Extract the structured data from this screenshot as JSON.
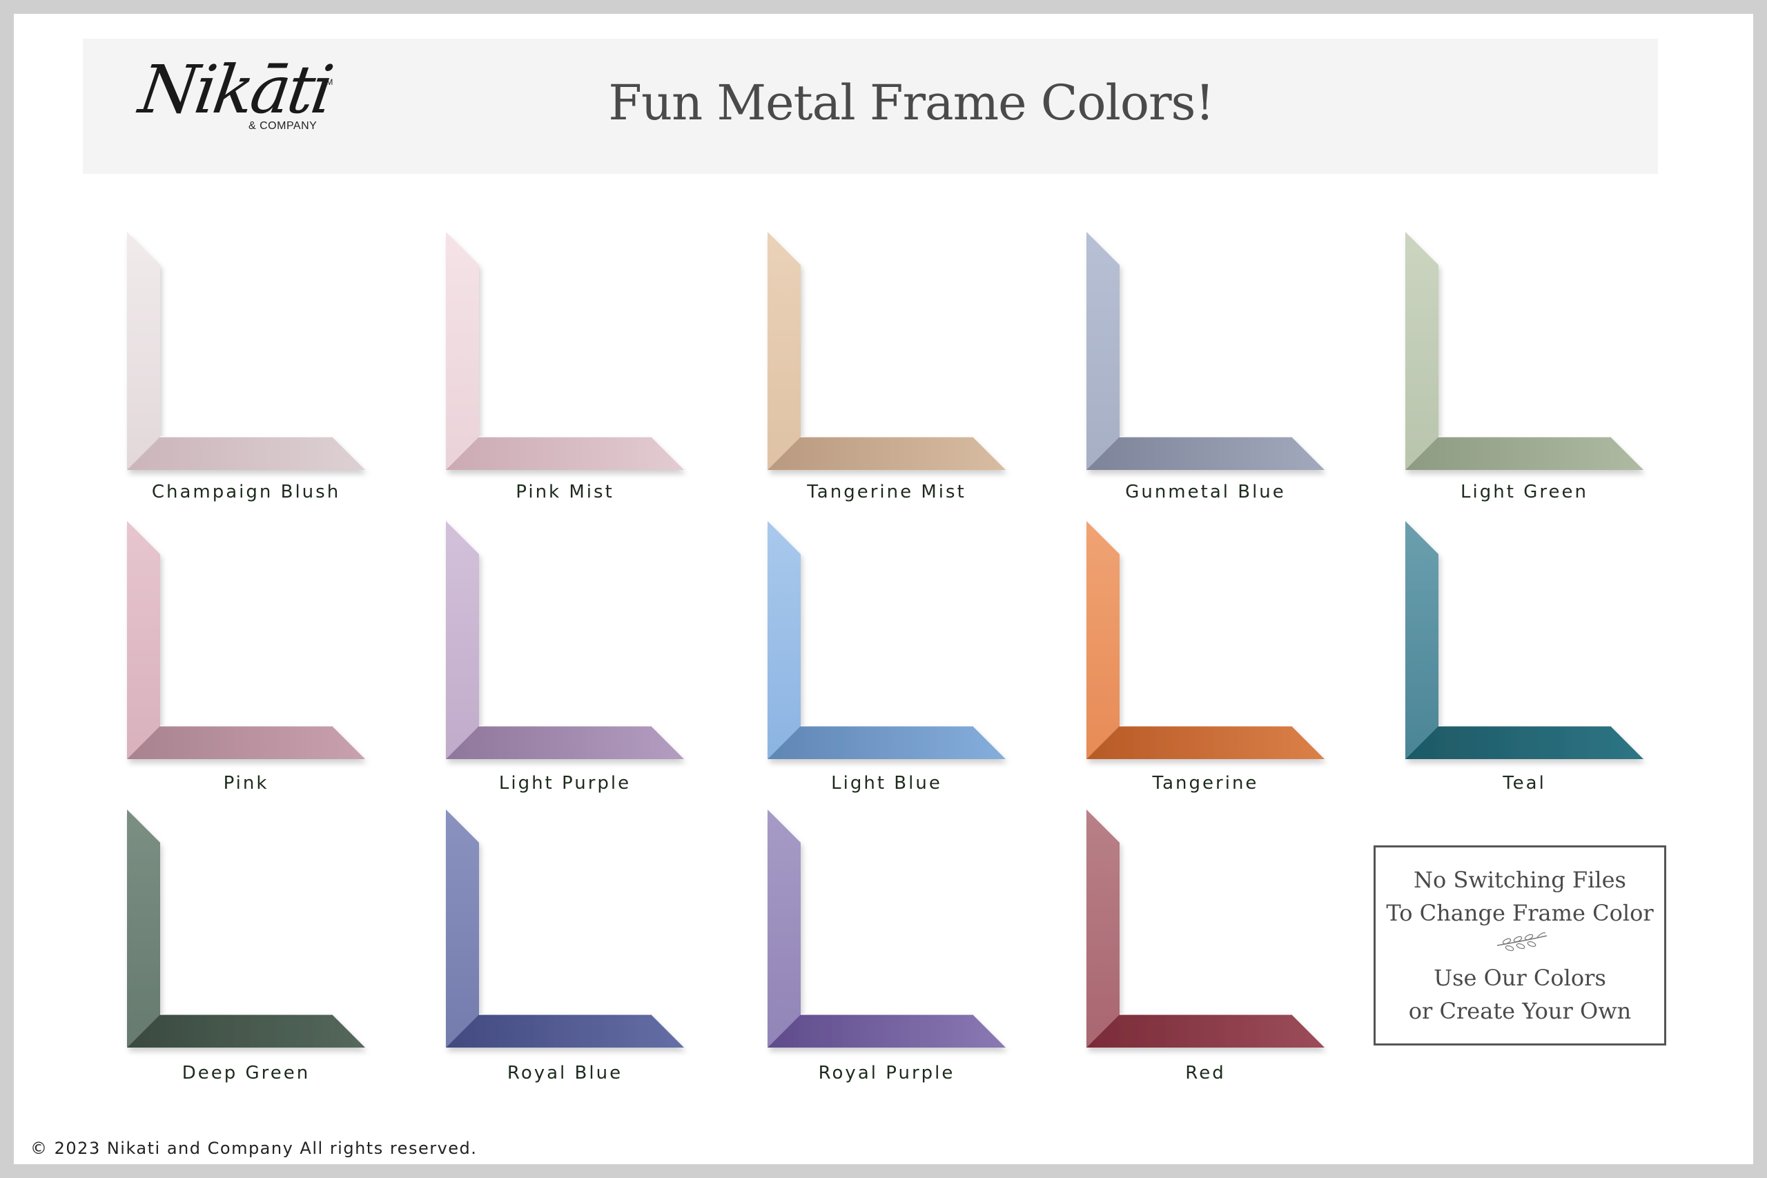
{
  "brand": {
    "logo_script": "Nikāti",
    "logo_tm": "TM",
    "logo_company": "& COMPANY"
  },
  "header": {
    "title": "Fun Metal Frame Colors!"
  },
  "frames": [
    {
      "label": "Champaign Blush",
      "side_top": "#f1ebec",
      "side_bottom": "#e2d8da",
      "base_left": "#cbb5ba",
      "base_right": "#ddd0d3"
    },
    {
      "label": "Pink Mist",
      "side_top": "#f5e3e7",
      "side_bottom": "#ead3d8",
      "base_left": "#ccaab3",
      "base_right": "#e2ccd1"
    },
    {
      "label": "Tangerine Mist",
      "side_top": "#ead2b8",
      "side_bottom": "#dfc2a5",
      "base_left": "#b99a80",
      "base_right": "#d8bca1"
    },
    {
      "label": "Gunmetal Blue",
      "side_top": "#b7c0d4",
      "side_bottom": "#a6afc4",
      "base_left": "#7d8499",
      "base_right": "#a2a9bd"
    },
    {
      "label": "Light Green",
      "side_top": "#cbd5c0",
      "side_bottom": "#b9c4ad",
      "base_left": "#8e9b83",
      "base_right": "#aebaa2"
    },
    {
      "label": "Pink",
      "side_top": "#e7c6cf",
      "side_bottom": "#d8b1bc",
      "base_left": "#a98290",
      "base_right": "#c9a1ae"
    },
    {
      "label": "Light Purple",
      "side_top": "#d3c1da",
      "side_bottom": "#c1abcb",
      "base_left": "#8f779b",
      "base_right": "#b39dc0"
    },
    {
      "label": "Light Blue",
      "side_top": "#a9c9ec",
      "side_bottom": "#8cb4e2",
      "base_left": "#5f86b5",
      "base_right": "#86aedc"
    },
    {
      "label": "Tangerine",
      "side_top": "#f0a374",
      "side_bottom": "#e78b56",
      "base_left": "#b75a26",
      "base_right": "#dc8049"
    },
    {
      "label": "Teal",
      "side_top": "#6b9fae",
      "side_bottom": "#4a8596",
      "base_left": "#1d5965",
      "base_right": "#2e7585"
    },
    {
      "label": "Deep Green",
      "side_top": "#7b8f83",
      "side_bottom": "#667a6f",
      "base_left": "#3a4a40",
      "base_right": "#55685c"
    },
    {
      "label": "Royal Blue",
      "side_top": "#8a92bf",
      "side_bottom": "#737cad",
      "base_left": "#424a80",
      "base_right": "#656ea6"
    },
    {
      "label": "Royal Purple",
      "side_top": "#a69bc6",
      "side_bottom": "#9184b7",
      "base_left": "#5f4b8c",
      "base_right": "#8a79b3"
    },
    {
      "label": "Red",
      "side_top": "#b98088",
      "side_bottom": "#a96670",
      "base_left": "#7a2b38",
      "base_right": "#9c4d5a"
    }
  ],
  "note": {
    "line1": "No Switching Files",
    "line2": "To Change Frame Color",
    "line3": "Use Our Colors",
    "line4": "or Create Your Own",
    "sprig_icon": "leaf-sprig-icon"
  },
  "footer": {
    "copyright": "© 2023 Nikati and Company All rights reserved."
  }
}
